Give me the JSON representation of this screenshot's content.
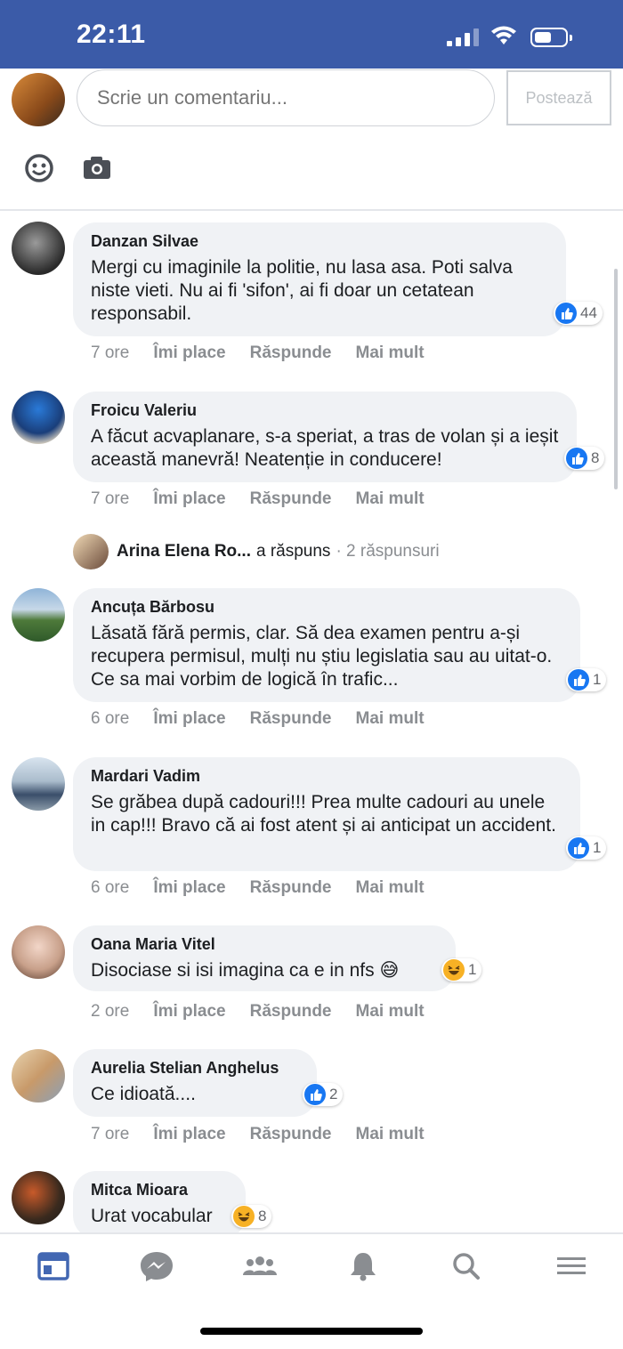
{
  "status_bar": {
    "time": "22:11"
  },
  "composer": {
    "placeholder": "Scrie un comentariu...",
    "post_label": "Postează"
  },
  "replies_row": {
    "name": "Arina Elena Ro...",
    "verb": "a răspuns",
    "count": "· 2 răspunsuri"
  },
  "comments": [
    {
      "author": "Danzan Silvae",
      "text": "Mergi cu imaginile la politie, nu lasa asa. Poti salva niste vieti. Nu ai fi 'sifon', ai fi doar un cetatean responsabil.",
      "reaction_type": "like",
      "reaction_count": "44",
      "time": "7 ore",
      "like_label": "Îmi place",
      "reply_label": "Răspunde",
      "more_label": "Mai mult"
    },
    {
      "author": "Froicu Valeriu",
      "text": "A făcut acvaplanare, s-a speriat, a tras de volan și a ieșit această manevră! Neatenție in conducere!",
      "reaction_type": "like",
      "reaction_count": "8",
      "time": "7 ore",
      "like_label": "Îmi place",
      "reply_label": "Răspunde",
      "more_label": "Mai mult"
    },
    {
      "author": "Ancuța Bărbosu",
      "text": "Lăsată fără permis, clar. Să dea examen pentru a-și recupera permisul, mulți nu știu legislatia sau au uitat-o. Ce sa mai vorbim de logică în trafic...",
      "reaction_type": "like",
      "reaction_count": "1",
      "time": "6 ore",
      "like_label": "Îmi place",
      "reply_label": "Răspunde",
      "more_label": "Mai mult"
    },
    {
      "author": "Mardari Vadim",
      "text": "Se grăbea după cadouri!!! Prea multe cadouri au unele in cap!!! Bravo că ai fost atent și ai anticipat un accident.",
      "reaction_type": "like",
      "reaction_count": "1",
      "time": "6 ore",
      "like_label": "Îmi place",
      "reply_label": "Răspunde",
      "more_label": "Mai mult"
    },
    {
      "author": "Oana Maria Vitel",
      "text": "Disociase si isi imagina ca e in nfs 😅",
      "reaction_type": "haha",
      "reaction_count": "1",
      "time": "2 ore",
      "like_label": "Îmi place",
      "reply_label": "Răspunde",
      "more_label": "Mai mult"
    },
    {
      "author": "Aurelia Stelian Anghelus",
      "text": "Ce idioată....",
      "reaction_type": "like",
      "reaction_count": "2",
      "time": "7 ore",
      "like_label": "Îmi place",
      "reply_label": "Răspunde",
      "more_label": "Mai mult"
    },
    {
      "author": "Mitca Mioara",
      "text": "Urat vocabular",
      "reaction_type": "haha",
      "reaction_count": "8"
    }
  ],
  "bottom_nav": [
    "news-feed-icon",
    "messenger-icon",
    "groups-icon",
    "notifications-icon",
    "search-icon",
    "menu-icon"
  ],
  "colors": {
    "header_bg": "#3b5ba8",
    "like_blue": "#1877f2",
    "active_nav": "#4267b2",
    "inactive_nav": "#8a8d91",
    "bubble_bg": "#f0f2f5"
  }
}
